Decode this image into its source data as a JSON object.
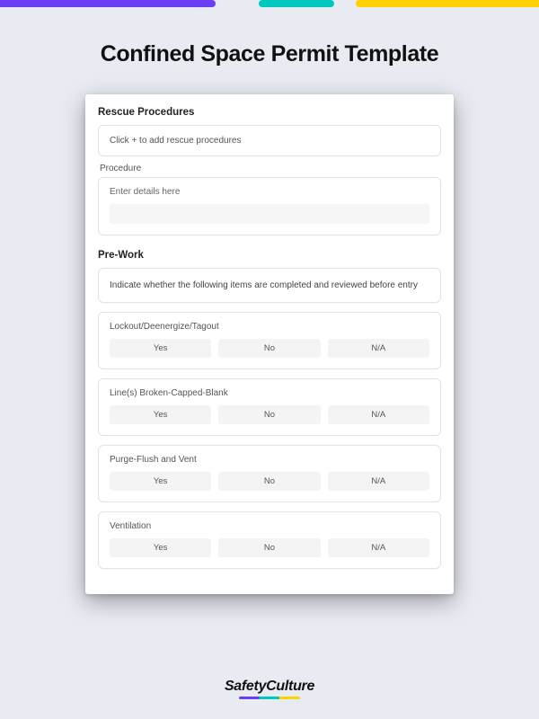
{
  "page": {
    "title": "Confined Space Permit Template"
  },
  "rescue": {
    "heading": "Rescue Procedures",
    "add_hint": "Click + to add rescue procedures",
    "procedure_label": "Procedure",
    "details_label": "Enter details here"
  },
  "prework": {
    "heading": "Pre-Work",
    "instruction": "Indicate whether the following items are completed and reviewed before entry",
    "options": {
      "yes": "Yes",
      "no": "No",
      "na": "N/A"
    },
    "items": [
      {
        "label": "Lockout/Deenergize/Tagout"
      },
      {
        "label": "Line(s) Broken-Capped-Blank"
      },
      {
        "label": "Purge-Flush and Vent"
      },
      {
        "label": "Ventilation"
      }
    ]
  },
  "logo": {
    "text": "SafetyCulture"
  }
}
